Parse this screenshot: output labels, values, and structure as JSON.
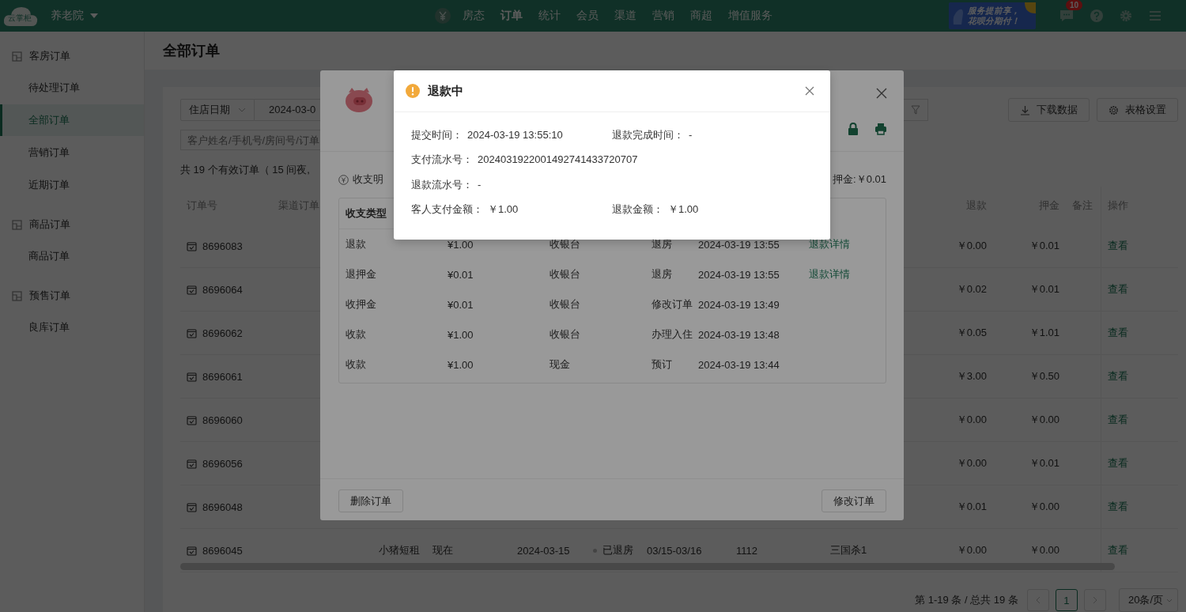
{
  "topbar": {
    "logo": "云掌柜",
    "hotel": "养老院",
    "nav": [
      {
        "label": "房态",
        "selected": false
      },
      {
        "label": "订单",
        "selected": true
      },
      {
        "label": "统计",
        "selected": false
      },
      {
        "label": "会员",
        "selected": false
      },
      {
        "label": "渠道",
        "selected": false
      },
      {
        "label": "营销",
        "selected": false
      },
      {
        "label": "商超",
        "selected": false
      },
      {
        "label": "增值服务",
        "selected": false
      }
    ],
    "banner": [
      "服务提前享，",
      "花呗分期付！"
    ],
    "message_count": "10"
  },
  "sidebar": {
    "groups": [
      {
        "title": "客房订单",
        "items": [
          {
            "label": "待处理订单",
            "selected": false
          },
          {
            "label": "全部订单",
            "selected": true
          },
          {
            "label": "营销订单",
            "selected": false
          },
          {
            "label": "近期订单",
            "selected": false
          }
        ]
      },
      {
        "title": "商品订单",
        "items": [
          {
            "label": "商品订单",
            "selected": false
          }
        ]
      },
      {
        "title": "预售订单",
        "items": [
          {
            "label": "良库订单",
            "selected": false
          }
        ]
      }
    ]
  },
  "page_title": "全部订单",
  "filters": {
    "date_type": "住店日期",
    "date_value": "2024-03-0",
    "search_placeholder": "客户姓名/手机号/房间号/订单",
    "buttons": [
      "下载数据",
      "表格设置"
    ]
  },
  "summary": "共 19 个有效订单（ 15 间夜,",
  "table": {
    "columns": [
      "订单号",
      "渠道订单",
      "退款",
      "押金",
      "备注",
      "操作"
    ],
    "rows": [
      {
        "order_no": "8696083",
        "refund": "￥0.00",
        "deposit": "￥0.01",
        "action": "查看"
      },
      {
        "order_no": "8696064",
        "refund": "￥0.02",
        "deposit": "￥0.01",
        "action": "查看"
      },
      {
        "order_no": "8696062",
        "refund": "￥0.05",
        "deposit": "￥1.01",
        "action": "查看"
      },
      {
        "order_no": "8696061",
        "refund": "￥3.00",
        "deposit": "￥0.50",
        "action": "查看"
      },
      {
        "order_no": "8696060",
        "refund": "￥0.00",
        "deposit": "￥0.00",
        "action": "查看"
      },
      {
        "order_no": "8696056",
        "refund": "￥0.00",
        "deposit": "￥0.01",
        "action": "查看"
      },
      {
        "order_no": "8696048",
        "refund": "￥0.01",
        "deposit": "￥0.00",
        "action": "查看"
      },
      {
        "order_no": "8696045",
        "channel": "小猪短租",
        "column_4": "现在",
        "check_in": "2024-03-15",
        "status": "已退房",
        "stay_dates": "03/15-03/16",
        "room": "1112",
        "guest": "三国杀1",
        "refund": "￥0.00",
        "deposit": "￥0.00",
        "action": "查看"
      }
    ]
  },
  "pagination": {
    "range": "第 1-19 条 / 总共 19 条",
    "pages": [
      {
        "label": "1",
        "selected": true
      }
    ],
    "page_size": "20条/页"
  },
  "order_modal": {
    "section": "收支明",
    "deposit_total": "押金:￥0.01",
    "payments": {
      "columns": [
        "收支类型"
      ],
      "rows": [
        [
          "退款",
          "¥1.00",
          "收银台",
          "退房",
          "2024-03-19 13:55",
          "退款详情"
        ],
        [
          "退押金",
          "¥0.01",
          "收银台",
          "退房",
          "2024-03-19 13:55",
          "退款详情"
        ],
        [
          "收押金",
          "¥0.01",
          "收银台",
          "修改订单",
          "2024-03-19 13:49"
        ],
        [
          "收款",
          "¥1.00",
          "收银台",
          "办理入住",
          "2024-03-19 13:48"
        ],
        [
          "收款",
          "¥1.00",
          "现金",
          "预订",
          "2024-03-19 13:44"
        ]
      ]
    },
    "footer_buttons": [
      "删除订单",
      "修改订单"
    ]
  },
  "refund_dialog": {
    "title": "退款中",
    "rows": [
      {
        "fields": [
          {
            "label": "提交时间：",
            "value": "2024-03-19 13:55:10"
          },
          {
            "label": "退款完成时间：",
            "value": "-"
          }
        ]
      },
      {
        "fields": [
          {
            "label": "支付流水号：",
            "value": "2024031922001492741433720707"
          }
        ]
      },
      {
        "fields": [
          {
            "label": "退款流水号：",
            "value": "-"
          }
        ]
      },
      {
        "fields": [
          {
            "label": "客人支付金额：",
            "value": "￥1.00"
          },
          {
            "label": "退款金额：",
            "value": "￥1.00"
          }
        ]
      }
    ]
  }
}
